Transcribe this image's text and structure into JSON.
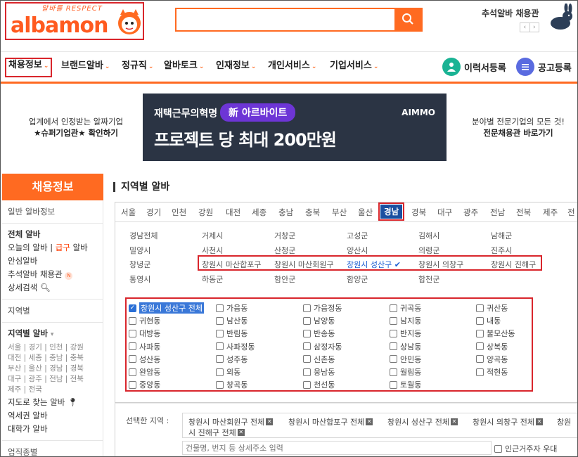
{
  "header": {
    "logo_tagline": "알바를 RESPECT",
    "logo_text": "albamon",
    "search_placeholder": "",
    "ad_small": "",
    "ad_title": "추석알바 채용관",
    "ad_prev": "‹",
    "ad_next": "›"
  },
  "gnb": {
    "items": [
      "채용정보",
      "브랜드알바",
      "정규직",
      "알바토크",
      "인재정보",
      "개인서비스",
      "기업서비스"
    ],
    "resume_register": "이력서등록",
    "job_register": "공고등록"
  },
  "banners": {
    "left_line1": "업계에서 인정받는 알짜기업",
    "left_line2": "★슈퍼기업관★ 확인하기",
    "main_sub": "재택근무의혁명",
    "main_pill": "新 아르바이트",
    "main_big": "프로젝트 당 최대 200만원",
    "main_brand": "AIMMO",
    "right_line1": "분야별 전문기업의 모든 것!",
    "right_line2": "전문채용관 바로가기"
  },
  "sidebar": {
    "title": "채용정보",
    "section_general": "일반 알바정보",
    "all_jobs": "전체 알바",
    "today_prefix": "오늘의 알바 | ",
    "today_urgent": "급구",
    "today_suffix": " 알바",
    "safe_jobs": "안심알바",
    "chuseok": "추석알바 채용관",
    "detail_search": "상세검색",
    "section_region": "지역별",
    "region_jobs": "지역별 알바",
    "region_row1": "서울 | 경기 | 인천 | 강원",
    "region_row2": "대전 | 세종 | 충남 | 충북",
    "region_row3": "부산 | 울산 | 경남 | 경북",
    "region_row4": "대구 | 광주 | 전남 | 전북",
    "region_row5": "제주 | 전국",
    "map_jobs": "지도로 찾는 알바",
    "station_jobs": "역세권 알바",
    "campus_jobs": "대학가 알바",
    "section_industry": "업직종별"
  },
  "main": {
    "title": "지역별 알바",
    "tabs": [
      "서울",
      "경기",
      "인천",
      "강원",
      "대전",
      "세종",
      "충남",
      "충북",
      "부산",
      "울산",
      "경남",
      "경북",
      "대구",
      "광주",
      "전남",
      "전북",
      "제주",
      "전"
    ],
    "active_tab": "경남",
    "districts": [
      "경남전체",
      "거제시",
      "거창군",
      "고성군",
      "김해시",
      "남해군",
      "밀양시",
      "사천시",
      "산청군",
      "양산시",
      "의령군",
      "진주시",
      "창녕군",
      "창원시 마산합포구",
      "창원시 마산회원구",
      "창원시 성산구",
      "창원시 의창구",
      "창원시 진해구",
      "통영시",
      "하동군",
      "함안군",
      "함양군",
      "합천군"
    ],
    "selected_district": "창원시 성산구",
    "dongs": [
      "창원시 성산구 전체",
      "가음동",
      "가음정동",
      "귀곡동",
      "귀산동",
      "귀현동",
      "남산동",
      "남양동",
      "남지동",
      "내동",
      "대방동",
      "반림동",
      "반송동",
      "반지동",
      "불모산동",
      "사파동",
      "사파정동",
      "삼정자동",
      "상남동",
      "상복동",
      "성산동",
      "성주동",
      "신촌동",
      "안민동",
      "양곡동",
      "완암동",
      "외동",
      "웅남동",
      "월림동",
      "적현동",
      "중앙동",
      "창곡동",
      "천선동",
      "토월동"
    ],
    "selected_label": "선택한 지역 :",
    "chips": [
      "창원시 마산회원구 전체",
      "창원시 마산합포구 전체",
      "창원시 성산구 전체",
      "창원시 의창구 전체",
      "창원",
      "시 진해구 전체"
    ],
    "address_placeholder": "건물명, 번지 등 상세주소 입력",
    "near_me": "인근거주자 우대"
  },
  "colors": {
    "accent": "#ff6a21",
    "highlight_red": "#d9262c",
    "active_blue": "#1a4fa0"
  }
}
